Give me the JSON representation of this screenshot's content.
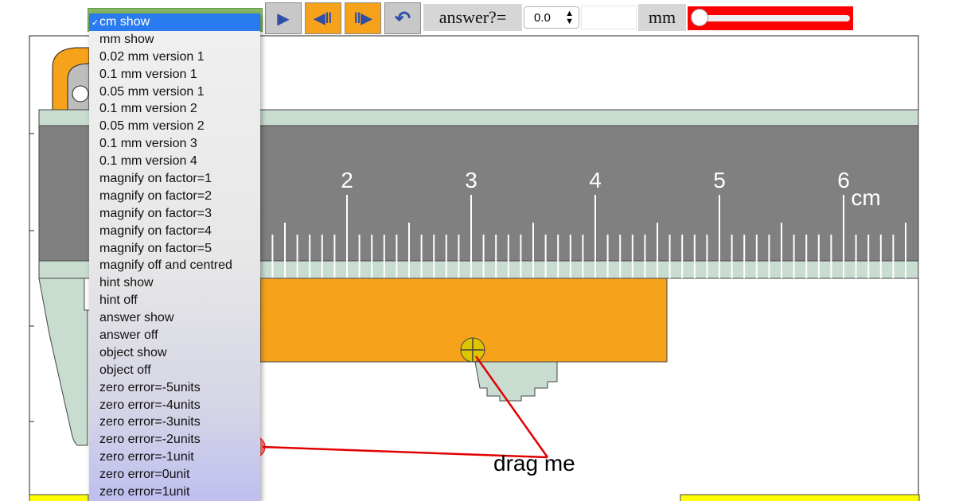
{
  "toolbar": {
    "buttons": [
      {
        "name": "play",
        "glyph": "▶"
      },
      {
        "name": "step-back",
        "glyph": "◀|"
      },
      {
        "name": "step-forward",
        "glyph": "|▶"
      },
      {
        "name": "reset",
        "glyph": "↶"
      }
    ],
    "answer_label": "answer?=",
    "answer_select_value": "0.0",
    "unit_label": "mm",
    "slider_value": 0
  },
  "dropdown": {
    "selected": "cm show",
    "options": [
      "cm show",
      "mm show",
      "0.02 mm version 1",
      "0.1 mm version 1",
      "0.05 mm version 1",
      "0.1 mm version 2",
      "0.05 mm version 2",
      "0.1 mm version 3",
      "0.1 mm version 4",
      "magnify on factor=1",
      "magnify on factor=2",
      "magnify on factor=3",
      "magnify on factor=4",
      "magnify on factor=5",
      "magnify off and centred",
      "hint show",
      "hint off",
      "answer show",
      "answer off",
      "object show",
      "object off",
      "zero error=-5units",
      "zero error=-4units",
      "zero error=-3units",
      "zero error=-2units",
      "zero error=-1unit",
      "zero error=0unit",
      "zero error=1unit"
    ]
  },
  "scale": {
    "numbers": [
      "2",
      "3",
      "4",
      "5",
      "6"
    ],
    "unit": "cm"
  },
  "drag_label": "drag me",
  "colors": {
    "ruler": "#808080",
    "rail": "#c8ddd0",
    "jaw": "#f7a21b",
    "slider_bg": "#ff0000",
    "selection": "#2a7bef"
  }
}
